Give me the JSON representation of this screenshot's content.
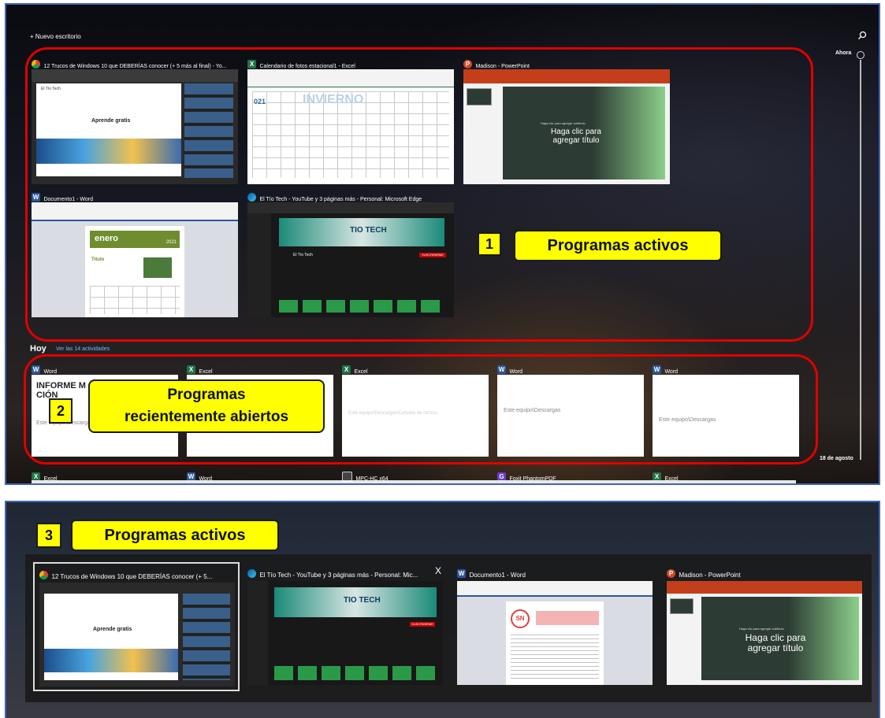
{
  "timeline": {
    "new_desktop": "+ Nuevo escritorio",
    "now_label": "Ahora",
    "date_label": "18 de agosto",
    "today_label": "Hoy",
    "see_all_link": "Ver las 14 actividades"
  },
  "active_windows": [
    {
      "title": "12 Trucos de Windows 10 que DEBERÍAS conocer (+ 5 más al final) - Yo...",
      "icon": "chrome-icon"
    },
    {
      "title": "Calendario de fotos estacional1 - Excel",
      "icon": "excel-icon"
    },
    {
      "title": "Madison - PowerPoint",
      "icon": "powerpoint-icon"
    },
    {
      "title": "Documento1 - Word",
      "icon": "word-icon"
    },
    {
      "title": "El Tío Tech - YouTube y 3 páginas más - Personal: Microsoft Edge",
      "icon": "edge-icon"
    }
  ],
  "window_content": {
    "chrome_heading": "Aprende gratis",
    "chrome_site": "El Tío Tech",
    "excel_text": "INVIERNO",
    "excel_year": "021",
    "ppt_small": "Haga clic para agregar subtítulo",
    "ppt_title": "Haga clic para agregar título",
    "word_month": "enero",
    "word_year": "2021",
    "word_section": "Título",
    "edge_banner": "TIO TECH",
    "edge_channel": "El Tío Tech",
    "edge_button": "SUSCRIBIRME",
    "word2_initials": "SN"
  },
  "recent": [
    {
      "app": "Word",
      "preview": "INFORME M S SIÓ C CIÓN",
      "subtitle": "Este equipo\\Descargas",
      "icon": "word-icon"
    },
    {
      "app": "Excel",
      "preview": "",
      "subtitle": "",
      "icon": "excel-icon"
    },
    {
      "app": "Excel",
      "preview": "",
      "subtitle": "Este equipo\\Descargas\\Carpeta de cursos",
      "icon": "excel-icon"
    },
    {
      "app": "Word",
      "preview": "",
      "subtitle": "Este equipo\\Descargas",
      "icon": "word-icon"
    },
    {
      "app": "Word",
      "preview": "",
      "subtitle": "Este equipo\\Descargas",
      "icon": "word-icon"
    }
  ],
  "bottom_row": [
    {
      "app": "Excel",
      "icon": "excel-icon"
    },
    {
      "app": "Word",
      "icon": "word-icon"
    },
    {
      "app": "MPC-HC x64",
      "icon": "mpc-icon"
    },
    {
      "app": "Foxit PhantomPDF",
      "icon": "foxit-icon"
    },
    {
      "app": "Excel",
      "icon": "excel-icon"
    }
  ],
  "callouts": {
    "c1_num": "1",
    "c1_text": "Programas activos",
    "c2_num": "2",
    "c2_line1": "Programas",
    "c2_line2": "recientemente abiertos",
    "c3_num": "3",
    "c3_text": "Programas activos"
  },
  "alt_tab": [
    {
      "title": "12 Trucos de Windows 10 que DEBERÍAS conocer (+ 5...",
      "icon": "chrome-icon"
    },
    {
      "title": "El Tío Tech - YouTube y 3 páginas más - Personal: Mic...",
      "icon": "edge-icon",
      "close": "X"
    },
    {
      "title": "Documento1 - Word",
      "icon": "word-icon"
    },
    {
      "title": "Madison - PowerPoint",
      "icon": "powerpoint-icon"
    }
  ],
  "colors": {
    "callout_fill": "#ffff00",
    "highlight_border": "#e00000",
    "panel_border": "#3f63b8"
  }
}
